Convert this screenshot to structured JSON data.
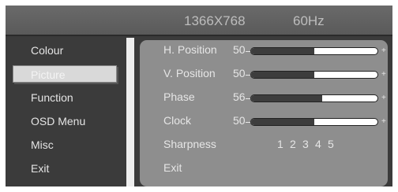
{
  "header": {
    "resolution": "1366X768",
    "refresh_rate": "60Hz"
  },
  "menu": {
    "items": [
      {
        "label": "Colour",
        "selected": false
      },
      {
        "label": "Picture",
        "selected": true
      },
      {
        "label": "Function",
        "selected": false
      },
      {
        "label": "OSD Menu",
        "selected": false
      },
      {
        "label": "Misc",
        "selected": false
      },
      {
        "label": "Exit",
        "selected": false
      }
    ]
  },
  "picture": {
    "h_position": {
      "label": "H. Position",
      "value": "50",
      "level": 0.5
    },
    "v_position": {
      "label": "V. Position",
      "value": "50",
      "level": 0.5
    },
    "phase": {
      "label": "Phase",
      "value": "56",
      "level": 0.56
    },
    "clock": {
      "label": "Clock",
      "value": "50",
      "level": 0.5
    },
    "sharpness": {
      "label": "Sharpness",
      "options": [
        "1",
        "2",
        "3",
        "4",
        "5"
      ]
    },
    "exit": {
      "label": "Exit"
    },
    "plus_symbol": "+"
  },
  "colors": {
    "background": "#3b3b3b",
    "header": "#5f5f5f",
    "panel": "#8e8e8e",
    "selected": "#d9d9d9"
  }
}
